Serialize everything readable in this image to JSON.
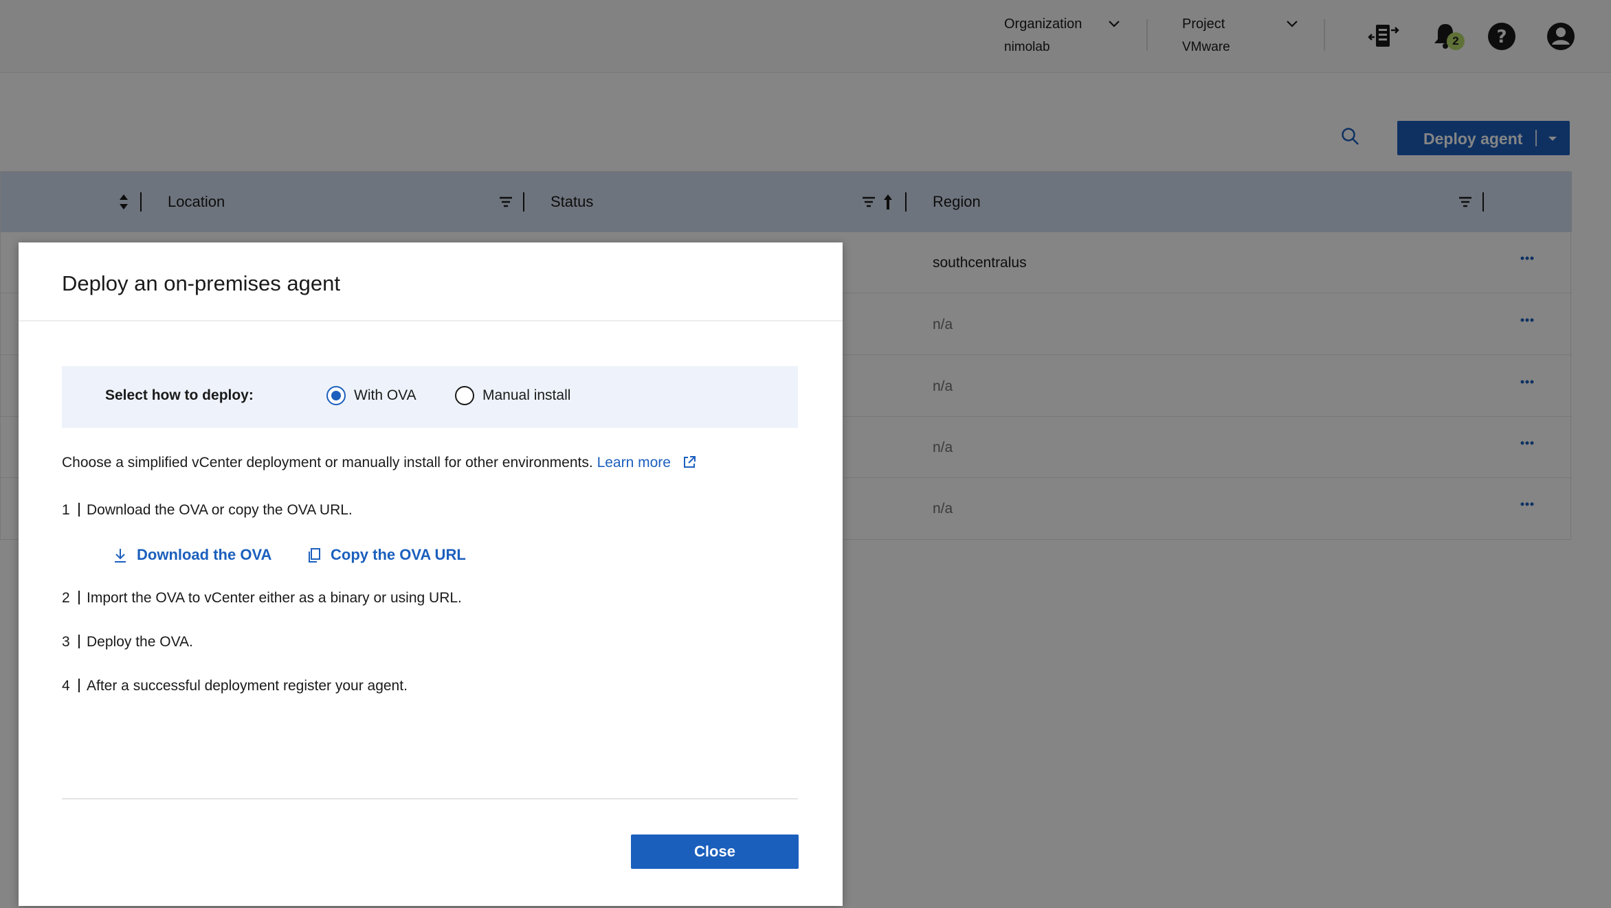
{
  "header": {
    "organization": {
      "label": "Organization",
      "value": "nimolab"
    },
    "project": {
      "label": "Project",
      "value": "VMware"
    },
    "notifications_count": "2"
  },
  "toolbar": {
    "deploy_label": "Deploy agent"
  },
  "table": {
    "columns": [
      "Location",
      "Status",
      "Region"
    ],
    "rows": [
      {
        "region": "southcentralus"
      },
      {
        "region": "n/a"
      },
      {
        "region": "n/a"
      },
      {
        "region": "n/a"
      },
      {
        "region": "n/a"
      }
    ]
  },
  "modal": {
    "title": "Deploy an on-premises agent",
    "select_label": "Select how to deploy:",
    "options": [
      "With OVA",
      "Manual install"
    ],
    "selected_option": "With OVA",
    "description": "Choose a simplified vCenter deployment or manually install for other environments.",
    "learn_more": "Learn more",
    "steps": [
      {
        "num": "1",
        "text": "Download the OVA or copy the OVA URL."
      },
      {
        "num": "2",
        "text": "Import the OVA to vCenter either as a binary or using URL."
      },
      {
        "num": "3",
        "text": "Deploy the OVA."
      },
      {
        "num": "4",
        "text": "After a successful deployment register your agent."
      }
    ],
    "download_label": "Download the OVA",
    "copy_label": "Copy the OVA URL",
    "close_label": "Close"
  },
  "colors": {
    "primary": "#1b5fbd",
    "table_header": "#d3dff0",
    "badge": "#b7d86a",
    "selector_bg": "#eef3fb"
  }
}
